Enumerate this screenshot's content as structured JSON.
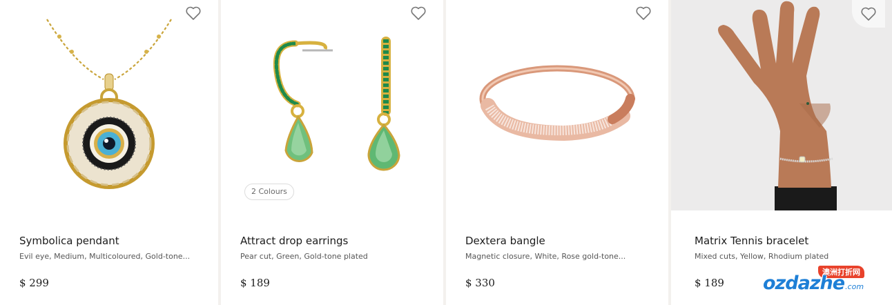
{
  "products": [
    {
      "name": "Symbolica pendant",
      "description": "Evil eye, Medium, Multicoloured, Gold-tone...",
      "price": "$ 299",
      "image": "pendant-image",
      "badge": ""
    },
    {
      "name": "Attract drop earrings",
      "description": "Pear cut, Green, Gold-tone plated",
      "price": "$ 189",
      "image": "earrings-image",
      "badge": "2 Colours"
    },
    {
      "name": "Dextera bangle",
      "description": "Magnetic closure, White, Rose gold-tone...",
      "price": "$ 330",
      "image": "bangle-image",
      "badge": ""
    },
    {
      "name": "Matrix Tennis bracelet",
      "description": "Mixed cuts, Yellow, Rhodium plated",
      "price": "$ 189",
      "image": "bracelet-on-hand-image",
      "badge": ""
    }
  ],
  "icons": {
    "favorite": "heart-outline-icon"
  },
  "colors": {
    "page_background": "#f3f1ee",
    "card_background": "#ffffff",
    "text": "#1c1c1c",
    "muted_text": "#555555"
  },
  "watermark": {
    "tag": "澳洲打折网",
    "logo": "ozdazhe",
    "domain": ".com"
  }
}
